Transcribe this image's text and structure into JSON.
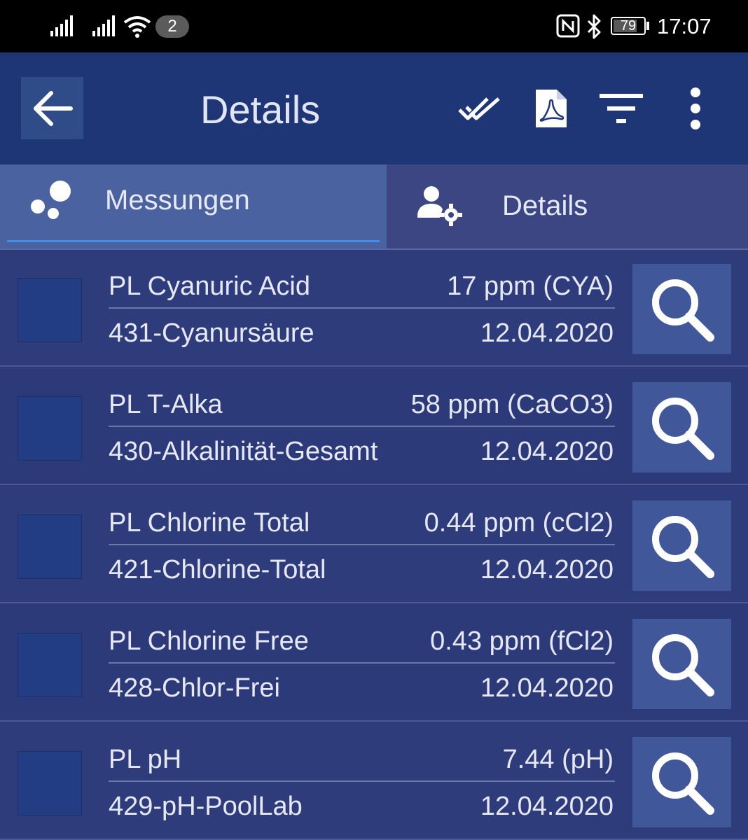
{
  "status_bar": {
    "notification_count": "2",
    "battery_level": "79",
    "battery_fraction": 0.79,
    "time": "17:07",
    "icons": [
      "signal-icon",
      "signal-icon",
      "wifi-icon",
      "nfc-icon",
      "bluetooth-icon",
      "battery-icon"
    ]
  },
  "app_bar": {
    "title": "Details",
    "icons": [
      "back-arrow-icon",
      "double-check-icon",
      "pdf-icon",
      "filter-icon",
      "more-vertical-icon"
    ]
  },
  "tabs": [
    {
      "label": "Messungen",
      "icon": "bubbles-icon",
      "selected": true
    },
    {
      "label": "Details",
      "icon": "user-settings-icon",
      "selected": false
    }
  ],
  "colors": {
    "app_bar": "#1e3675",
    "background": "#2e3a78",
    "tab_selected": "#4a62a0",
    "tab_indicator": "#3f8ef0",
    "search_button": "#40579a"
  },
  "measurements": [
    {
      "name": "PL Cyanuric Acid",
      "value": "17 ppm (CYA)",
      "method": "431-Cyanursäure",
      "date": "12.04.2020"
    },
    {
      "name": "PL T-Alka",
      "value": "58 ppm (CaCO3)",
      "method": "430-Alkalinität-Gesamt",
      "date": "12.04.2020"
    },
    {
      "name": "PL Chlorine Total",
      "value": "0.44 ppm (cCl2)",
      "method": "421-Chlorine-Total",
      "date": "12.04.2020"
    },
    {
      "name": "PL Chlorine Free",
      "value": "0.43 ppm (fCl2)",
      "method": "428-Chlor-Frei",
      "date": "12.04.2020"
    },
    {
      "name": "PL pH",
      "value": "7.44 (pH)",
      "method": "429-pH-PoolLab",
      "date": "12.04.2020"
    }
  ]
}
